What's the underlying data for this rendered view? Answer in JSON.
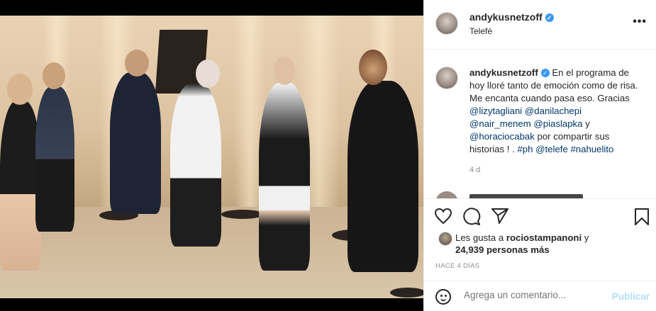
{
  "header": {
    "username": "andykusnetzoff",
    "location": "Telefé",
    "verified_mark": "✓",
    "more_label": "•••"
  },
  "caption": {
    "username": "andykusnetzoff",
    "text_1": "En el programa de hoy lloré tanto de emoción como de risa. Me encanta cuando pasa eso. Gracias ",
    "mention_1": "@lizytagliani",
    "sp_1": " ",
    "mention_2": "@danilachepi",
    "sp_2": " ",
    "mention_3": "@nair_menem",
    "sp_3": " ",
    "mention_4": "@piaslapka",
    "sep_1": " y ",
    "mention_5": "@horaciocabak",
    "text_2": " por compartir sus historias ! . ",
    "tag_1": "#ph",
    "sp_4": " ",
    "mention_6": "@telefe",
    "sp_5": " ",
    "tag_2": "#nahuelito",
    "age": "4 d"
  },
  "likes": {
    "prefix": "Les gusta a ",
    "user": "rociostampanoni",
    "joiner": " y",
    "count_text": "24,939 personas más"
  },
  "timestamp": "HACE 4 DÍAS",
  "comment": {
    "placeholder": "Agrega un comentario...",
    "post_label": "Publicar"
  },
  "icons": {
    "like": "heart-icon",
    "comment": "comment-icon",
    "share": "share-icon",
    "save": "bookmark-icon",
    "emoji": "emoji-icon"
  },
  "colors": {
    "link": "#00376b",
    "verified": "#3897f0",
    "post_disabled": "#b2dffc"
  }
}
